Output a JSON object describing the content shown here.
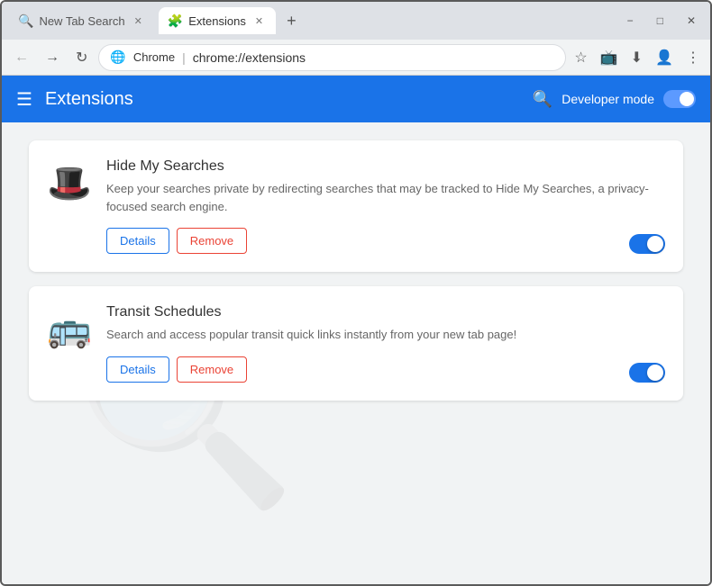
{
  "titleBar": {
    "tabs": [
      {
        "id": "new-tab-search",
        "label": "New Tab Search",
        "active": false,
        "icon": "🔍"
      },
      {
        "id": "extensions",
        "label": "Extensions",
        "active": true,
        "icon": "🧩"
      }
    ],
    "newTabBtn": "+",
    "windowControls": [
      "−",
      "□",
      "✕"
    ]
  },
  "addressBar": {
    "chromeIcon": "🌐",
    "brandText": "Chrome",
    "separator": "|",
    "urlText": "chrome://extensions",
    "bookmarkIcon": "☆",
    "castIcon": "📺",
    "profileIcon": "👤",
    "menuIcon": "⋮"
  },
  "header": {
    "hamburgerIcon": "☰",
    "title": "Extensions",
    "searchIcon": "🔍",
    "devModeLabel": "Developer mode"
  },
  "extensions": [
    {
      "id": "hide-my-searches",
      "name": "Hide My Searches",
      "description": "Keep your searches private by redirecting searches that may be tracked to Hide My Searches, a privacy-focused search engine.",
      "icon": "🎩",
      "detailsLabel": "Details",
      "removeLabel": "Remove",
      "enabled": true
    },
    {
      "id": "transit-schedules",
      "name": "Transit Schedules",
      "description": "Search and access popular transit quick links instantly from your new tab page!",
      "icon": "🚌",
      "detailsLabel": "Details",
      "removeLabel": "Remove",
      "enabled": true
    }
  ]
}
